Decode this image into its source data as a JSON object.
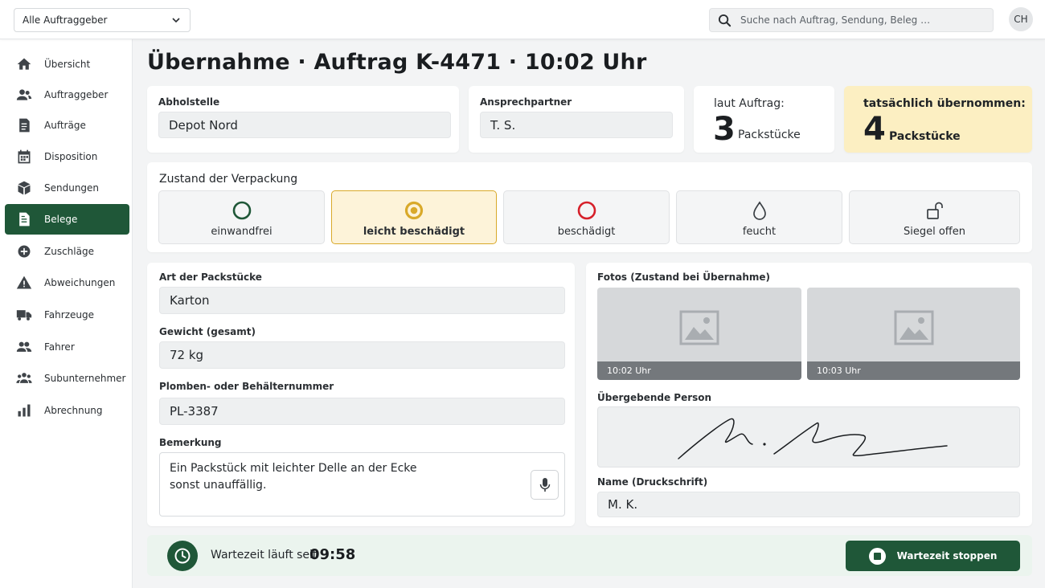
{
  "topbar": {
    "client_filter": "Alle Auftraggeber",
    "search_placeholder": "Suche nach Auftrag, Sendung, Beleg …",
    "user_initials": "CH"
  },
  "sidebar": {
    "items": [
      {
        "label": "Übersicht",
        "icon": "home-icon"
      },
      {
        "label": "Auftraggeber",
        "icon": "users-icon"
      },
      {
        "label": "Aufträge",
        "icon": "document-icon"
      },
      {
        "label": "Disposition",
        "icon": "calendar-icon"
      },
      {
        "label": "Sendungen",
        "icon": "package-icon"
      },
      {
        "label": "Belege",
        "icon": "receipt-icon",
        "active": true
      },
      {
        "label": "Zuschläge",
        "icon": "plus-circle-icon"
      },
      {
        "label": "Abweichungen",
        "icon": "warning-icon"
      },
      {
        "label": "Fahrzeuge",
        "icon": "truck-icon"
      },
      {
        "label": "Fahrer",
        "icon": "drivers-icon"
      },
      {
        "label": "Subunternehmer",
        "icon": "group-icon"
      },
      {
        "label": "Abrechnung",
        "icon": "bar-chart-icon"
      }
    ]
  },
  "page": {
    "title": "Übernahme · Auftrag K-4471 · 10:02 Uhr"
  },
  "pickup": {
    "label": "Abholstelle",
    "value": "Depot Nord"
  },
  "contact": {
    "label": "Ansprechpartner",
    "value": "T. S."
  },
  "ordered": {
    "label": "laut Auftrag:",
    "count": "3",
    "unit": "Packstücke"
  },
  "received": {
    "label": "tatsächlich übernommen:",
    "count": "4",
    "unit": "Packstücke",
    "highlight_color": "#fcefc2"
  },
  "condition": {
    "title": "Zustand der Verpackung",
    "options": [
      {
        "label": "einwandfrei",
        "icon": "circle-ok-icon",
        "color": "#1f5738"
      },
      {
        "label": "leicht beschädigt",
        "icon": "circle-warning-icon",
        "color": "#d9a92a",
        "selected": true
      },
      {
        "label": "beschädigt",
        "icon": "circle-damaged-icon",
        "color": "#d6202a"
      },
      {
        "label": "feucht",
        "icon": "droplet-icon"
      },
      {
        "label": "Siegel offen",
        "icon": "unlock-icon"
      }
    ]
  },
  "details": {
    "package_type": {
      "label": "Art der Packstücke",
      "value": "Karton"
    },
    "weight": {
      "label": "Gewicht (gesamt)",
      "value": "72 kg"
    },
    "seal_number": {
      "label": "Plomben- oder Behälternummer",
      "value": "PL-3387"
    },
    "remark": {
      "label": "Bemerkung",
      "line1": "Ein Packstück mit leichter Delle an der Ecke",
      "line2": "sonst unauffällig."
    }
  },
  "photos": {
    "label": "Fotos (Zustand bei Übernahme)",
    "items": [
      {
        "time": "10:02 Uhr"
      },
      {
        "time": "10:03 Uhr"
      }
    ]
  },
  "signature": {
    "label": "Übergebende Person"
  },
  "print_name": {
    "label": "Name (Druckschrift)",
    "value": "M. K."
  },
  "wait": {
    "text": "Wartezeit läuft seit",
    "time": "09:58",
    "button": "Wartezeit stoppen"
  },
  "colors": {
    "brand": "#1f5738",
    "accent": "#d9a92a",
    "danger": "#d6202a"
  }
}
